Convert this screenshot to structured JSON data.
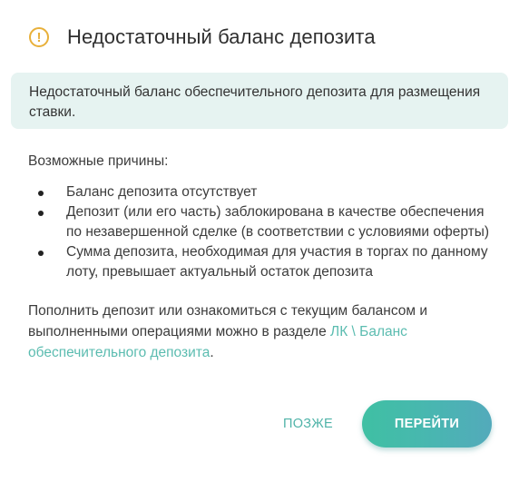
{
  "dialog": {
    "title": "Недостаточный баланс депозита",
    "icon": "warning-circle-icon",
    "accent_color": "#4fb3a8",
    "warning_color": "#e8b03a"
  },
  "alert": {
    "text": "Недостаточный баланс обеспечительного депозита для размещения ставки."
  },
  "body": {
    "reasons_title": "Возможные причины:",
    "reasons": [
      "Баланс депозита отсутствует",
      "Депозит (или его часть) заблокирована в качестве обеспечения по незавершенной сделке (в соответствии с условиями оферты)",
      "Сумма депозита, необходимая для участия в торгах по данному лоту, превышает актуальный остаток депозита"
    ],
    "outro_text": "Пополнить депозит или ознакомиться с текущим балансом и выполненными операциями можно в разделе ",
    "outro_link": "ЛК \\ Баланс обеспечительного депозита",
    "outro_end": "."
  },
  "actions": {
    "later_label": "ПОЗЖЕ",
    "go_label": "ПЕРЕЙТИ"
  }
}
